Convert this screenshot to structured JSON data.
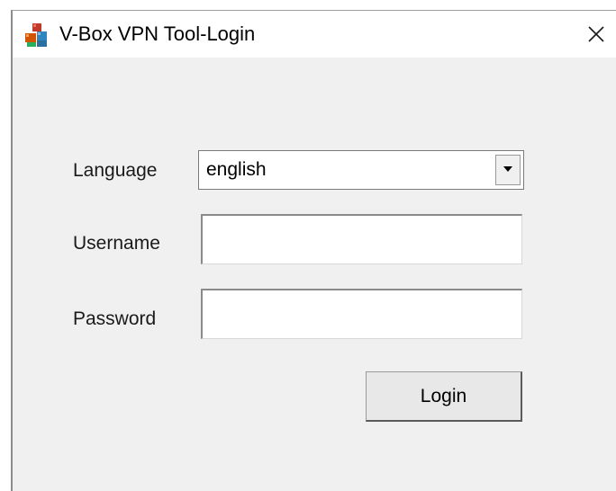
{
  "window": {
    "title": "V-Box VPN Tool-Login",
    "icon": "app-blocks-icon",
    "close_icon": "close-icon"
  },
  "form": {
    "language_label": "Language",
    "language_value": "english",
    "username_label": "Username",
    "username_value": "",
    "password_label": "Password",
    "password_value": "",
    "login_label": "Login"
  },
  "colors": {
    "background": "#f0f0f0",
    "titlebar": "#ffffff",
    "input_bg": "#ffffff"
  }
}
